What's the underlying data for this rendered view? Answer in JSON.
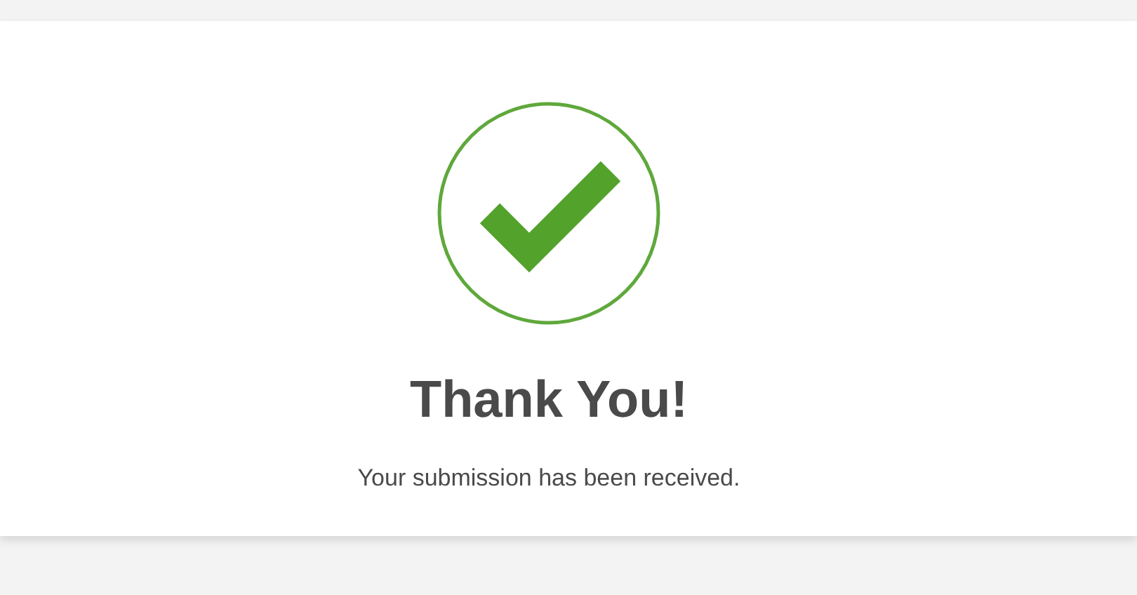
{
  "confirmation": {
    "title": "Thank You!",
    "message": "Your submission has been received."
  }
}
